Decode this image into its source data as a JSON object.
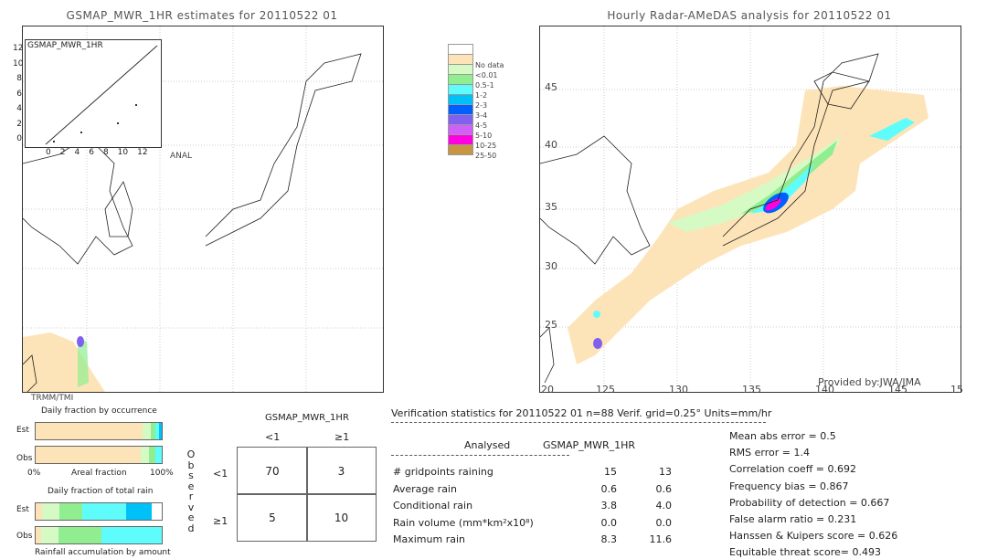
{
  "left_map": {
    "title": "GSMAP_MWR_1HR estimates for 20110522 01",
    "inset_title": "GSMAP_MWR_1HR",
    "inset_y_ticks": [
      "12",
      "10",
      "8",
      "6",
      "4",
      "2",
      "0"
    ],
    "inset_x_ticks": [
      "0",
      "2",
      "4",
      "6",
      "8",
      "10",
      "12"
    ],
    "anal_label": "ANAL",
    "sensor": "TRMM/TMI"
  },
  "right_map": {
    "title": "Hourly Radar-AMeDAS analysis for 20110522 01",
    "lat_ticks": [
      "45",
      "40",
      "35",
      "30",
      "25"
    ],
    "lon_ticks": [
      "20",
      "125",
      "130",
      "135",
      "140",
      "145",
      "15"
    ],
    "credit": "Provided by:JWA/JMA"
  },
  "legend": [
    {
      "label": "",
      "color": "#ffffff"
    },
    {
      "label": "No data",
      "color": "#fde4b8"
    },
    {
      "label": "<0.01",
      "color": "#d6fac4"
    },
    {
      "label": "0.5-1",
      "color": "#90ee90"
    },
    {
      "label": "1-2",
      "color": "#5ffcfc"
    },
    {
      "label": "2-3",
      "color": "#00c0f8"
    },
    {
      "label": "3-4",
      "color": "#0060ff"
    },
    {
      "label": "4-5",
      "color": "#8060f0"
    },
    {
      "label": "5-10",
      "color": "#d060f8"
    },
    {
      "label": "10-25",
      "color": "#ff00e0"
    },
    {
      "label": "25-50",
      "color": "#c89640"
    }
  ],
  "chart_data": [
    {
      "type": "bar",
      "title": "Daily fraction by occurrence",
      "xlabel": "Areal fraction",
      "x_ticks": [
        "0%",
        "100%"
      ],
      "categories": [
        "Est",
        "Obs"
      ],
      "series": [
        {
          "values": [
            [
              0.85,
              "#fde4b8"
            ],
            [
              0.06,
              "#d6fac4"
            ],
            [
              0.04,
              "#90ee90"
            ],
            [
              0.03,
              "#5ffcfc"
            ],
            [
              0.02,
              "#00c0f8"
            ]
          ]
        },
        {
          "values": [
            [
              0.83,
              "#fde4b8"
            ],
            [
              0.07,
              "#d6fac4"
            ],
            [
              0.05,
              "#90ee90"
            ],
            [
              0.05,
              "#5ffcfc"
            ]
          ]
        }
      ]
    },
    {
      "type": "bar",
      "title": "Daily fraction of total rain",
      "xlabel": "Rainfall accumulation by amount",
      "categories": [
        "Est",
        "Obs"
      ],
      "series": [
        {
          "values": [
            [
              0.05,
              "#fde4b8"
            ],
            [
              0.14,
              "#d6fac4"
            ],
            [
              0.18,
              "#90ee90"
            ],
            [
              0.35,
              "#5ffcfc"
            ],
            [
              0.2,
              "#00c0f8"
            ]
          ]
        },
        {
          "values": [
            [
              0.04,
              "#fde4b8"
            ],
            [
              0.14,
              "#d6fac4"
            ],
            [
              0.34,
              "#90ee90"
            ],
            [
              0.48,
              "#5ffcfc"
            ]
          ]
        }
      ]
    },
    {
      "type": "table",
      "title": "GSMAP_MWR_1HR",
      "col_labels": [
        "<1",
        "≥1"
      ],
      "row_title": "Observed",
      "row_labels": [
        "<1",
        "≥1"
      ],
      "values": [
        [
          70,
          3
        ],
        [
          5,
          10
        ]
      ]
    }
  ],
  "stats": {
    "header": "Verification statistics for 20110522 01   n=88   Verif. grid=0.25°   Units=mm/hr",
    "col1": "Analysed",
    "col2": "GSMAP_MWR_1HR",
    "rows": [
      {
        "label": "# gridpoints raining",
        "a": "15",
        "b": "13"
      },
      {
        "label": "Average rain",
        "a": "0.6",
        "b": "0.6"
      },
      {
        "label": "Conditional rain",
        "a": "3.8",
        "b": "4.0"
      },
      {
        "label": "Rain volume (mm*km²x10⁸)",
        "a": "0.0",
        "b": "0.0"
      },
      {
        "label": "Maximum rain",
        "a": "8.3",
        "b": "11.6"
      }
    ],
    "scores": [
      "Mean abs error = 0.5",
      "RMS error = 1.4",
      "Correlation coeff = 0.692",
      "Frequency bias = 0.867",
      "Probability of detection = 0.667",
      "False alarm ratio = 0.231",
      "Hanssen & Kuipers score = 0.626",
      "Equitable threat score= 0.493"
    ]
  }
}
